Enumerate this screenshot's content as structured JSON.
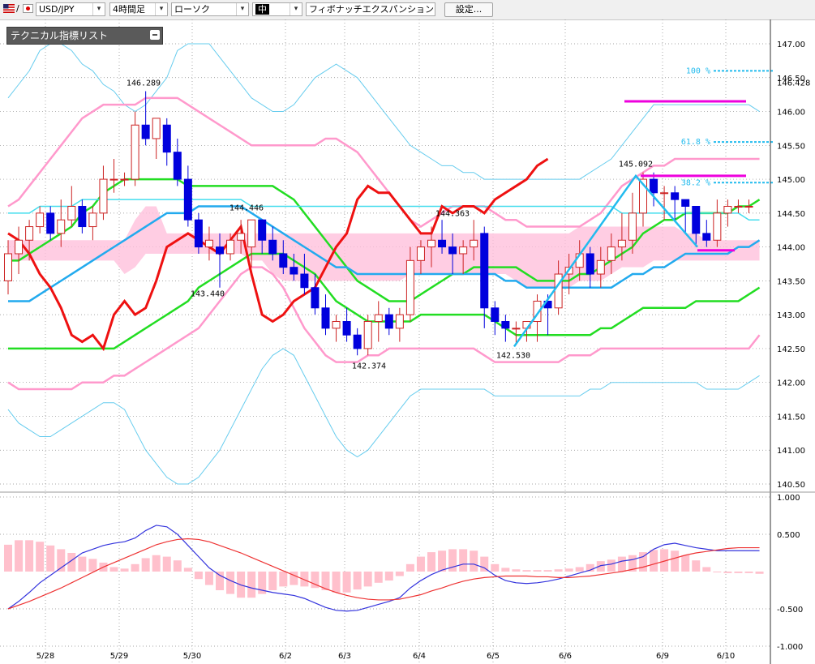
{
  "toolbar": {
    "symbol": "USD/JPY",
    "symbol_prefix": "/",
    "timeframe": "4時間足",
    "chart_style": "ローソク",
    "size": "中",
    "tool": "フィボナッチエクスパンション",
    "settings_label": "設定..."
  },
  "panel": {
    "title": "テクニカル指標リスト"
  },
  "colors": {
    "up": "#cc2222",
    "down": "#0000dd",
    "bb_outer": "#66ccee",
    "bb_mid": "#ff99cc",
    "ma": "#22dd22",
    "ma_long": "#22dd22",
    "ema": "#22aaee",
    "rsi": "#ee1111",
    "cloud": "#ffc0dc",
    "cloud2": "#b8d8f4",
    "macd": "#3333dd",
    "signal": "#ee3333",
    "hist": "#ffc0cc",
    "fib": "#22bbee",
    "magenta": "#ee00dd"
  },
  "chart_data": [
    {
      "type": "candlestick",
      "yaxis": {
        "min": 140.5,
        "max": 147.0,
        "ticks": [
          "147.00",
          "146.50",
          "146.00",
          "145.50",
          "145.00",
          "144.50",
          "144.00",
          "143.50",
          "143.00",
          "142.50",
          "142.00",
          "141.50",
          "141.00",
          "140.50"
        ]
      },
      "xaxis": {
        "labels": [
          "5/28",
          "5/29",
          "5/30",
          "6/2",
          "6/3",
          "6/4",
          "6/5",
          "6/6",
          "6/9",
          "6/10"
        ]
      },
      "candles": [
        [
          143.5,
          144.1,
          143.3,
          143.9
        ],
        [
          143.9,
          144.3,
          143.6,
          144.1
        ],
        [
          144.1,
          144.4,
          143.8,
          144.3
        ],
        [
          144.3,
          144.6,
          144.2,
          144.5
        ],
        [
          144.5,
          144.6,
          144.1,
          144.2
        ],
        [
          144.2,
          144.7,
          144.0,
          144.4
        ],
        [
          144.4,
          144.9,
          144.3,
          144.6
        ],
        [
          144.6,
          144.7,
          144.2,
          144.3
        ],
        [
          144.3,
          144.6,
          144.1,
          144.5
        ],
        [
          144.5,
          145.2,
          144.4,
          145.0
        ],
        [
          145.0,
          145.3,
          144.8,
          145.0
        ],
        [
          145.0,
          145.1,
          144.9,
          145.0
        ],
        [
          145.0,
          146.0,
          144.9,
          145.8
        ],
        [
          145.8,
          146.3,
          145.5,
          145.6
        ],
        [
          145.6,
          145.9,
          145.3,
          145.9
        ],
        [
          145.8,
          145.9,
          145.2,
          145.4
        ],
        [
          145.4,
          145.6,
          144.9,
          145.0
        ],
        [
          145.0,
          145.2,
          144.3,
          144.4
        ],
        [
          144.4,
          144.5,
          143.9,
          144.0
        ],
        [
          144.0,
          144.3,
          143.8,
          144.1
        ],
        [
          144.0,
          144.2,
          143.4,
          143.9
        ],
        [
          143.9,
          144.2,
          143.8,
          144.1
        ],
        [
          144.1,
          144.4,
          143.9,
          144.2
        ],
        [
          144.0,
          144.4,
          143.7,
          144.4
        ],
        [
          144.4,
          144.4,
          143.9,
          144.1
        ],
        [
          144.1,
          144.3,
          143.8,
          143.9
        ],
        [
          143.9,
          144.1,
          143.6,
          143.7
        ],
        [
          143.7,
          143.9,
          143.5,
          143.6
        ],
        [
          143.6,
          143.9,
          143.3,
          143.4
        ],
        [
          143.4,
          143.6,
          143.0,
          143.1
        ],
        [
          143.1,
          143.3,
          142.7,
          142.8
        ],
        [
          142.8,
          143.0,
          142.6,
          142.9
        ],
        [
          142.9,
          143.1,
          142.6,
          142.7
        ],
        [
          142.7,
          142.8,
          142.4,
          142.5
        ],
        [
          142.5,
          143.0,
          142.4,
          142.9
        ],
        [
          142.9,
          143.2,
          142.6,
          143.0
        ],
        [
          143.0,
          143.1,
          142.7,
          142.8
        ],
        [
          142.8,
          143.1,
          142.6,
          143.0
        ],
        [
          143.0,
          144.0,
          142.9,
          143.8
        ],
        [
          143.8,
          144.1,
          143.6,
          144.0
        ],
        [
          144.0,
          144.3,
          143.7,
          144.1
        ],
        [
          144.1,
          144.4,
          143.9,
          144.0
        ],
        [
          144.0,
          144.2,
          143.6,
          143.9
        ],
        [
          143.9,
          144.1,
          143.6,
          144.0
        ],
        [
          144.0,
          144.4,
          143.8,
          144.1
        ],
        [
          144.2,
          144.3,
          142.8,
          143.1
        ],
        [
          143.1,
          143.2,
          142.7,
          142.9
        ],
        [
          142.9,
          143.0,
          142.6,
          142.8
        ],
        [
          142.8,
          142.9,
          142.55,
          142.8
        ],
        [
          142.8,
          142.9,
          142.6,
          142.9
        ],
        [
          142.9,
          143.3,
          142.6,
          143.2
        ],
        [
          143.2,
          143.3,
          142.7,
          143.1
        ],
        [
          143.1,
          143.8,
          143.0,
          143.6
        ],
        [
          143.6,
          143.9,
          143.3,
          143.7
        ],
        [
          143.7,
          144.1,
          143.5,
          143.9
        ],
        [
          143.9,
          144.0,
          143.4,
          143.6
        ],
        [
          143.6,
          144.0,
          143.4,
          143.8
        ],
        [
          143.8,
          144.2,
          143.6,
          144.0
        ],
        [
          144.0,
          144.5,
          143.8,
          144.1
        ],
        [
          144.1,
          144.8,
          143.9,
          144.5
        ],
        [
          144.5,
          145.1,
          144.3,
          145.0
        ],
        [
          145.0,
          145.1,
          144.6,
          144.8
        ],
        [
          144.8,
          144.9,
          144.4,
          144.8
        ],
        [
          144.8,
          144.9,
          144.4,
          144.7
        ],
        [
          144.7,
          144.7,
          144.2,
          144.6
        ],
        [
          144.6,
          144.6,
          144.0,
          144.2
        ],
        [
          144.2,
          144.4,
          144.0,
          144.1
        ],
        [
          144.1,
          144.7,
          144.0,
          144.5
        ],
        [
          144.5,
          144.7,
          144.3,
          144.6
        ],
        [
          144.6,
          144.7,
          144.5,
          144.6
        ],
        [
          144.6,
          144.7,
          144.5,
          144.6
        ]
      ],
      "annotations": [
        {
          "text": "146.289",
          "value": 146.289
        },
        {
          "text": "143.440",
          "value": 143.44
        },
        {
          "text": "144.446",
          "value": 144.446
        },
        {
          "text": "142.374",
          "value": 142.374
        },
        {
          "text": "144.363",
          "value": 144.363
        },
        {
          "text": "142.530",
          "value": 142.53
        },
        {
          "text": "145.092",
          "value": 145.092
        }
      ],
      "current_price": "146.428",
      "fibonacci": [
        {
          "label": "100 %",
          "value": 146.6
        },
        {
          "label": "61.8 %",
          "value": 145.55
        },
        {
          "label": "38.2 %",
          "value": 144.95
        }
      ],
      "magenta_levels": [
        146.15,
        145.05,
        143.95
      ]
    },
    {
      "type": "line",
      "subchart": "macd",
      "yaxis": {
        "min": -1.0,
        "max": 1.0,
        "ticks": [
          "1.000",
          "0.500",
          "-0.500",
          "-1.000"
        ]
      },
      "histogram": [
        0.36,
        0.42,
        0.42,
        0.4,
        0.35,
        0.3,
        0.25,
        0.2,
        0.17,
        0.12,
        0.06,
        0.04,
        0.1,
        0.18,
        0.22,
        0.2,
        0.15,
        0.05,
        -0.1,
        -0.18,
        -0.25,
        -0.3,
        -0.35,
        -0.35,
        -0.3,
        -0.25,
        -0.2,
        -0.18,
        -0.2,
        -0.22,
        -0.25,
        -0.28,
        -0.28,
        -0.24,
        -0.2,
        -0.15,
        -0.12,
        -0.06,
        0.1,
        0.2,
        0.26,
        0.28,
        0.3,
        0.3,
        0.28,
        0.2,
        0.1,
        0.05,
        0.03,
        0.02,
        0.02,
        0.02,
        0.03,
        0.04,
        0.06,
        0.1,
        0.14,
        0.16,
        0.2,
        0.22,
        0.26,
        0.29,
        0.3,
        0.28,
        0.22,
        0.15,
        0.06,
        0.0,
        -0.02,
        -0.02,
        -0.02,
        -0.03
      ],
      "macd": [
        -0.5,
        -0.4,
        -0.28,
        -0.15,
        -0.05,
        0.05,
        0.15,
        0.25,
        0.3,
        0.35,
        0.38,
        0.4,
        0.45,
        0.55,
        0.62,
        0.6,
        0.5,
        0.35,
        0.2,
        0.05,
        -0.05,
        -0.12,
        -0.18,
        -0.22,
        -0.25,
        -0.28,
        -0.3,
        -0.32,
        -0.36,
        -0.42,
        -0.48,
        -0.52,
        -0.53,
        -0.52,
        -0.48,
        -0.44,
        -0.4,
        -0.35,
        -0.22,
        -0.12,
        -0.04,
        0.02,
        0.06,
        0.1,
        0.1,
        0.05,
        -0.05,
        -0.12,
        -0.15,
        -0.16,
        -0.15,
        -0.13,
        -0.1,
        -0.06,
        -0.02,
        0.02,
        0.08,
        0.1,
        0.14,
        0.16,
        0.2,
        0.3,
        0.36,
        0.38,
        0.35,
        0.32,
        0.3,
        0.28,
        0.28,
        0.28,
        0.28,
        0.28
      ],
      "signal": [
        -0.5,
        -0.45,
        -0.4,
        -0.34,
        -0.28,
        -0.22,
        -0.15,
        -0.08,
        -0.01,
        0.06,
        0.12,
        0.18,
        0.24,
        0.3,
        0.36,
        0.4,
        0.43,
        0.44,
        0.43,
        0.4,
        0.35,
        0.3,
        0.25,
        0.19,
        0.13,
        0.07,
        0.01,
        -0.05,
        -0.11,
        -0.17,
        -0.23,
        -0.28,
        -0.32,
        -0.35,
        -0.37,
        -0.38,
        -0.38,
        -0.37,
        -0.34,
        -0.31,
        -0.26,
        -0.22,
        -0.17,
        -0.13,
        -0.1,
        -0.08,
        -0.07,
        -0.06,
        -0.06,
        -0.06,
        -0.07,
        -0.07,
        -0.08,
        -0.08,
        -0.07,
        -0.06,
        -0.04,
        -0.02,
        0.0,
        0.03,
        0.06,
        0.1,
        0.14,
        0.18,
        0.22,
        0.25,
        0.27,
        0.29,
        0.31,
        0.32,
        0.32,
        0.32
      ]
    }
  ]
}
